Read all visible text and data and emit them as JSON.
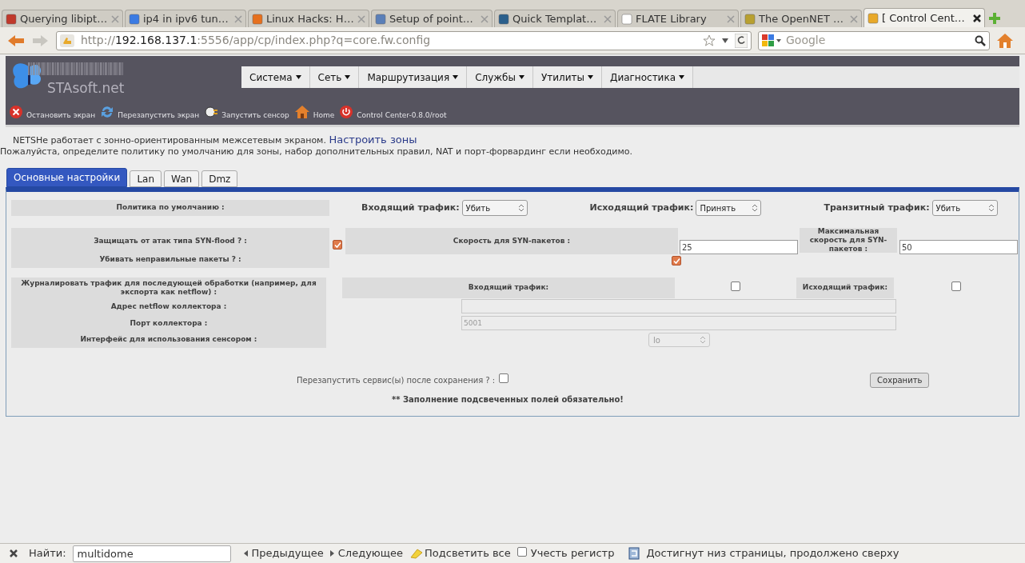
{
  "browser": {
    "tabs": [
      {
        "title": "Querying libipt…",
        "selected": false
      },
      {
        "title": "ip4 in ipv6 tun…",
        "selected": false
      },
      {
        "title": "Linux Hacks: H…",
        "selected": false
      },
      {
        "title": "Setup of point…",
        "selected": false
      },
      {
        "title": "Quick Templat…",
        "selected": false
      },
      {
        "title": "FLATE Library",
        "selected": false
      },
      {
        "title": "The OpenNET …",
        "selected": false
      },
      {
        "title": "[ Control Cent…",
        "selected": true
      }
    ],
    "url": {
      "scheme": "http://",
      "host": "192.168.137.1",
      "rest": ":5556/app/cp/index.php?q=core.fw.config"
    },
    "search": {
      "placeholder": "Google"
    }
  },
  "header": {
    "logo_text": "STAsoft.net",
    "menu": [
      {
        "label": "Система"
      },
      {
        "label": "Сеть"
      },
      {
        "label": "Маршрутизация"
      },
      {
        "label": "Службы"
      },
      {
        "label": "Утилиты"
      },
      {
        "label": "Диагностика"
      }
    ],
    "toolbar": [
      {
        "kind": "stop",
        "label": "Остановить экран"
      },
      {
        "kind": "restart",
        "label": "Перезапустить экран"
      },
      {
        "kind": "sensor",
        "label": "Запустить сенсор"
      },
      {
        "kind": "home",
        "label": "Home"
      },
      {
        "kind": "power",
        "label": "Control Center-0.8.0/root"
      }
    ]
  },
  "intro": {
    "text": "NETSHe работает с зонно-ориентированным межсетевым экраном.",
    "link": "Настроить зоны",
    "description": "Пожалуйста, определите политику по умолчанию для зоны, набор дополнительных правил, NAT и порт-форвардинг если необходимо."
  },
  "zone_tabs": [
    {
      "label": "Основные настройки",
      "selected": true
    },
    {
      "label": "Lan",
      "selected": false
    },
    {
      "label": "Wan",
      "selected": false
    },
    {
      "label": "Dmz",
      "selected": false
    }
  ],
  "policy": {
    "label": "Политика по умолчанию :",
    "selects": [
      {
        "label": "Входящий трафик:",
        "value": "Убить"
      },
      {
        "label": "Исходящий трафик:",
        "value": "Принять"
      },
      {
        "label": "Транзитный трафик:",
        "value": "Убить"
      }
    ]
  },
  "syn": {
    "label": "Защищать от атак типа SYN-flood ?  :",
    "checked": true,
    "rate_label": "Скорость для SYN-пакетов :",
    "rate_value": "25",
    "max_label": "Максимальная скорость для SYN-пакетов :",
    "max_value": "50"
  },
  "invalid": {
    "label": "Убивать неправильные пакеты ?  :",
    "checked": true
  },
  "logging": {
    "label": "Журналировать трафик для последующей обработки (например, для экспорта как netflow) :",
    "in_label": "Входящий трафик:",
    "in_checked": false,
    "out_label": "Исходящий трафик:",
    "out_checked": false,
    "collector_label": "Адрес netflow коллектора :",
    "port_label": "Порт коллектора :",
    "port_value": "5001",
    "iface_label": "Интерфейс для использования сенсором :",
    "iface_value": "lo",
    "disabled": true
  },
  "footer": {
    "restart_label": "Перезапустить сервис(ы) после сохранения ?  :",
    "restart_checked": false,
    "save": "Сохранить",
    "note": "** Заполнение подсвеченных полей обязательно!"
  },
  "find_bar": {
    "label": "Найти:",
    "value": "multidome",
    "previous": "Предыдущее",
    "next": "Следующее",
    "highlight": "Подсветить все",
    "match_case": "Учесть регистр",
    "match_case_checked": false,
    "status": "Достигнут низ страницы, продолжено сверху"
  }
}
